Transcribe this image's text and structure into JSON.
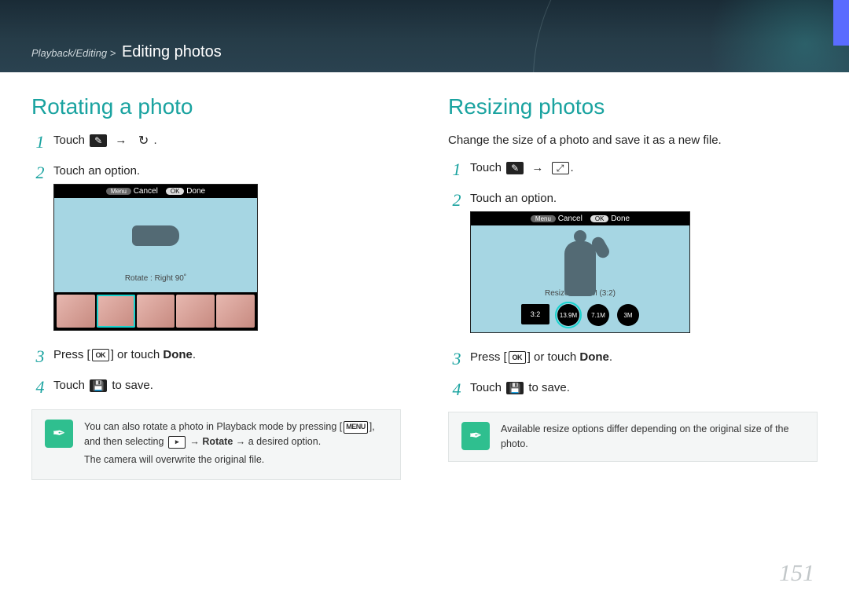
{
  "breadcrumb": {
    "parent": "Playback/Editing",
    "sep": ">",
    "current": "Editing photos"
  },
  "page_number": "151",
  "left": {
    "title": "Rotating a photo",
    "steps": {
      "s1a": "Touch",
      "s1b": ".",
      "s2": "Touch an option.",
      "s3a": "Press [",
      "s3b": "] or touch ",
      "s3c": "Done",
      "s3d": ".",
      "s4a": "Touch ",
      "s4b": " to save."
    },
    "shot": {
      "menu": "Menu",
      "cancel": "Cancel",
      "ok": "OK",
      "done": "Done",
      "caption": "Rotate : Right 90˚"
    },
    "note_l1a": "You can also rotate a photo in Playback mode by pressing [",
    "note_l1b": "], and then selecting ",
    "note_l1c": " → ",
    "note_l1_rotate": "Rotate",
    "note_l1d": " → a desired option.",
    "note_l2": "The camera will overwrite the original file."
  },
  "right": {
    "title": "Resizing photos",
    "intro": "Change the size of a photo and save it as a new file.",
    "steps": {
      "s1a": "Touch",
      "s1b": ".",
      "s2": "Touch an option.",
      "s3a": "Press [",
      "s3b": "] or touch ",
      "s3c": "Done",
      "s3d": ".",
      "s4a": "Touch ",
      "s4b": " to save."
    },
    "shot": {
      "menu": "Menu",
      "cancel": "Cancel",
      "ok": "OK",
      "done": "Done",
      "caption": "Resize : 13.9M (3:2)",
      "opts": [
        "3:2",
        "13.9M",
        "7.1M",
        "3M"
      ]
    },
    "note": "Available resize options differ depending on the original size of the photo."
  },
  "icons": {
    "edit": "✎",
    "rotate": "↻",
    "resize": "⤢",
    "ok": "OK",
    "save": "💾",
    "menu_key": "MENU",
    "play": "▸",
    "pen": "✒"
  }
}
